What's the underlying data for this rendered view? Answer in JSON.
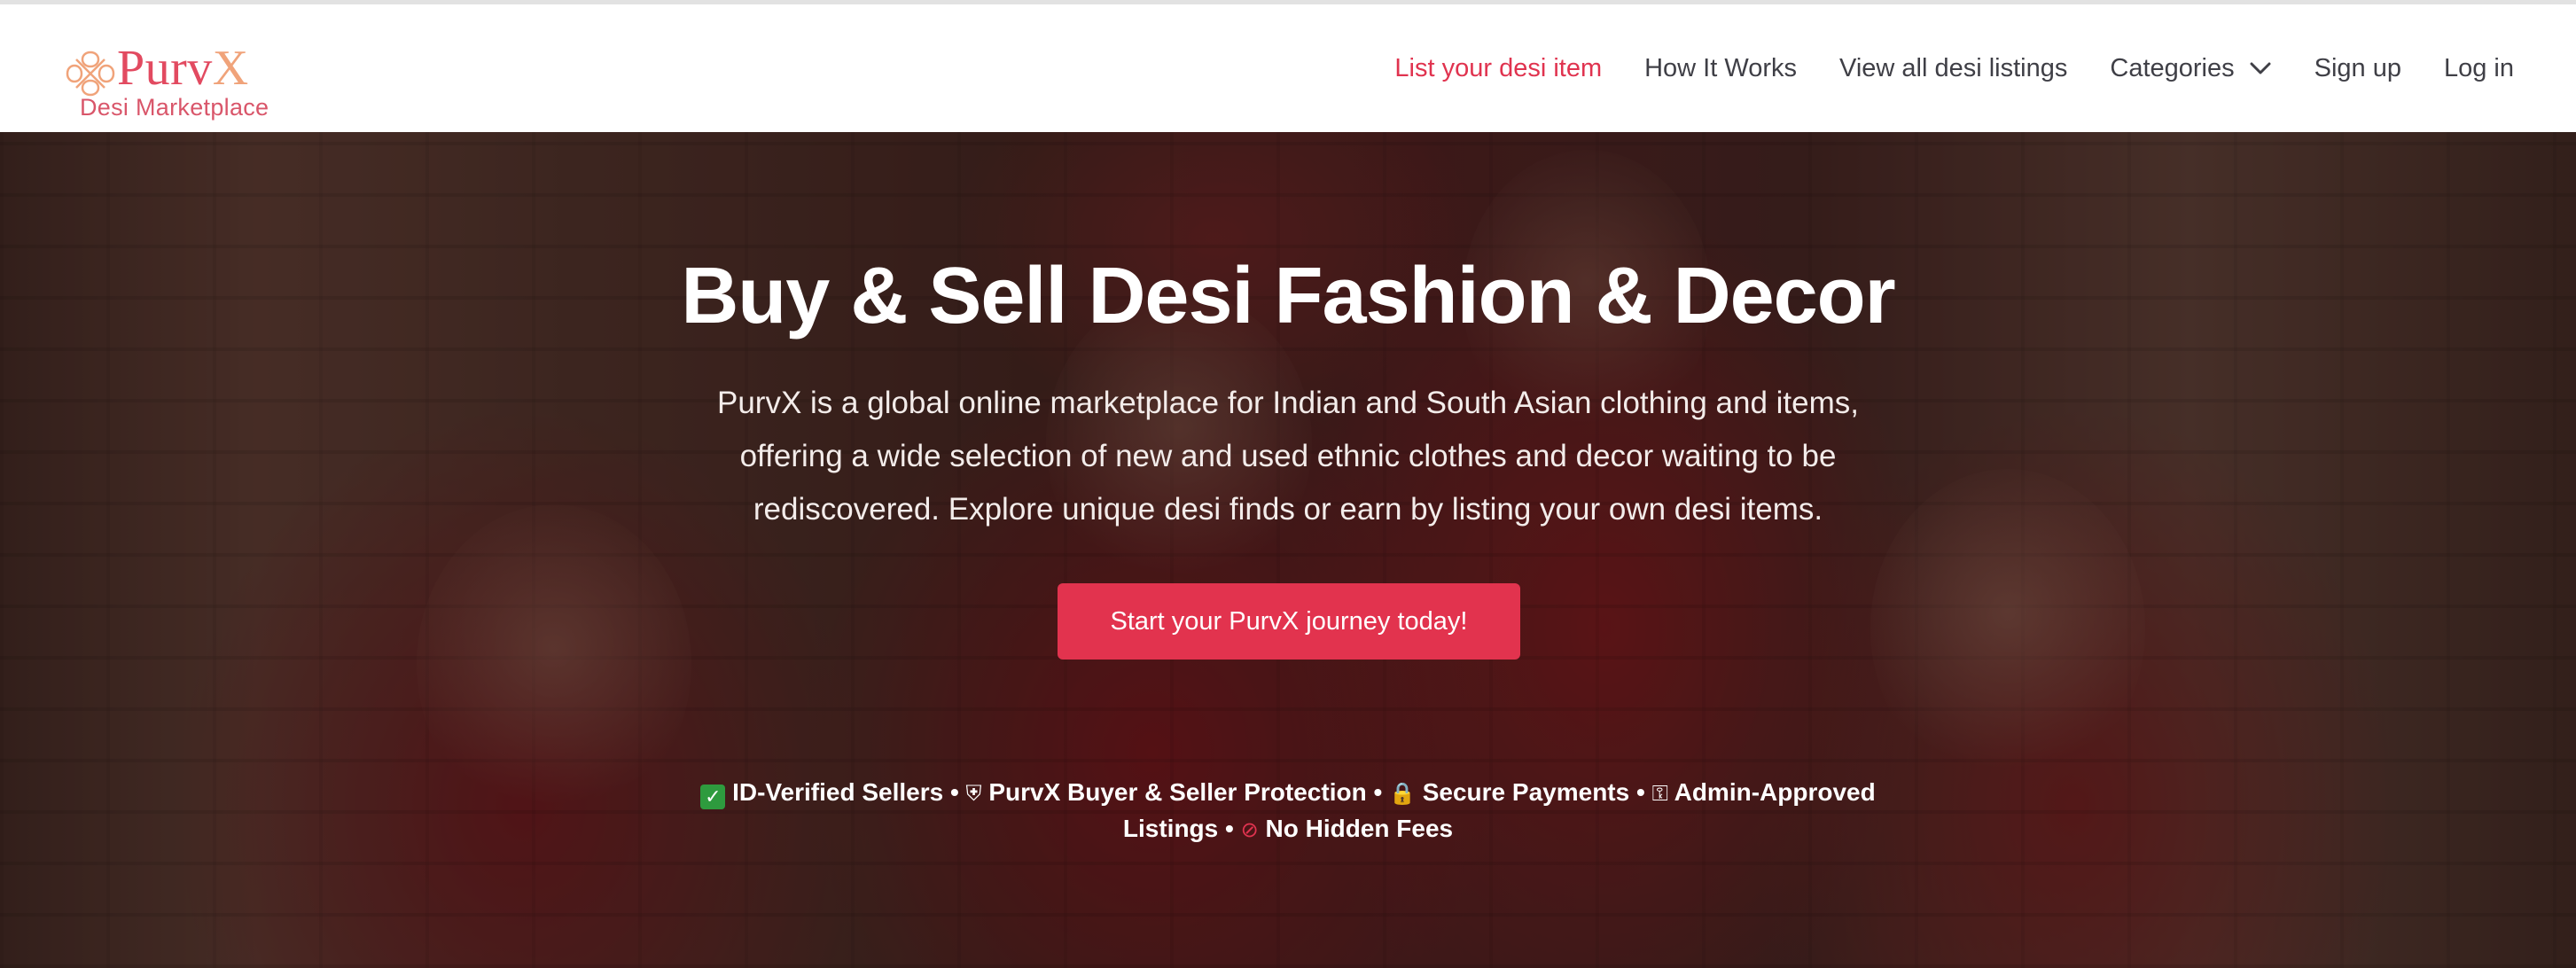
{
  "brand": {
    "name_main": "Purv",
    "name_accent": "X",
    "tagline": "Desi Marketplace"
  },
  "nav": {
    "list_item": "List your desi item",
    "how_it_works": "How It Works",
    "view_all": "View all desi listings",
    "categories": "Categories",
    "sign_up": "Sign up",
    "log_in": "Log in"
  },
  "hero": {
    "title": "Buy & Sell Desi Fashion & Decor",
    "description": "PurvX is a global online marketplace for Indian and South Asian clothing and items, offering a wide selection of new and used ethnic clothes and decor waiting to be rediscovered. Explore unique desi finds or earn by listing your own desi items.",
    "cta": "Start your PurvX journey today!",
    "trust": {
      "verified": "ID-Verified Sellers",
      "protection": "PurvX Buyer & Seller Protection",
      "payments": "Secure Payments",
      "approved": "Admin-Approved Listings",
      "fees": "No Hidden Fees",
      "separator": "•"
    }
  },
  "icons": {
    "logo": "knot-icon",
    "categories": "chevron-down-icon",
    "verified": "check-box-icon",
    "protection": "shield-icon",
    "payments": "lock-icon",
    "approved": "key-icon",
    "fees": "prohibited-icon"
  },
  "colors": {
    "accent": "#e2334e",
    "logo_primary": "#e24a60",
    "logo_secondary": "#f0a37a",
    "nav_text": "#3f3f46"
  }
}
